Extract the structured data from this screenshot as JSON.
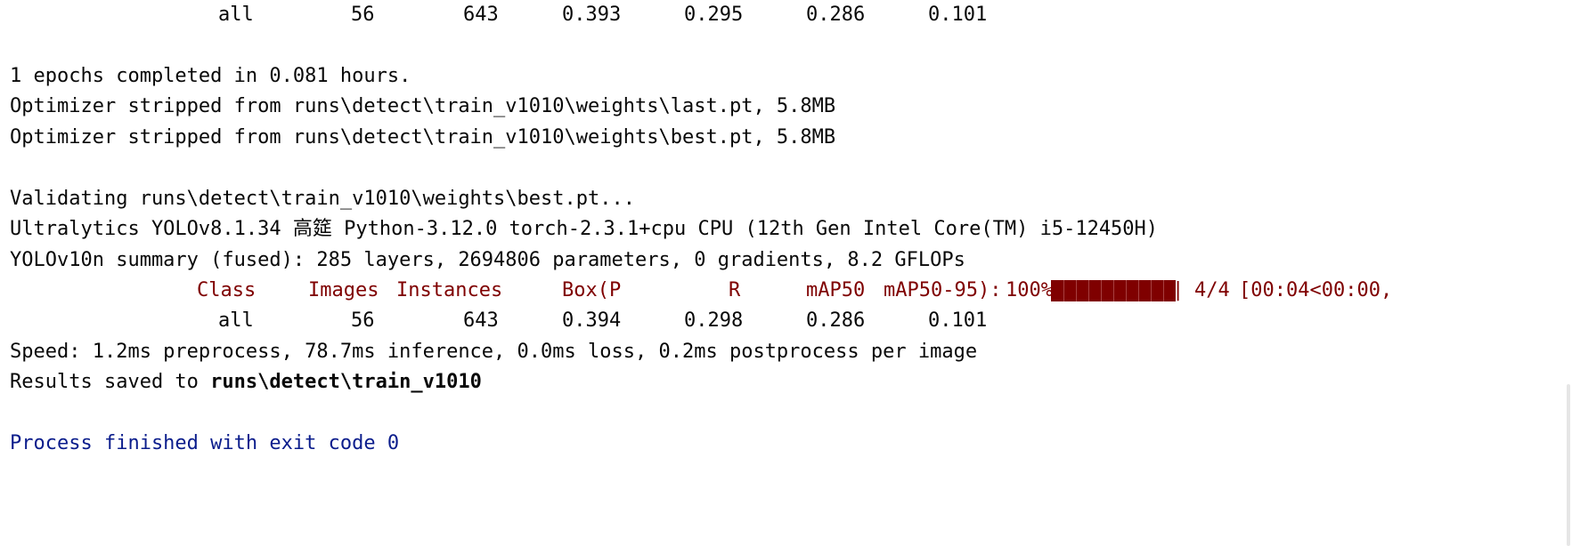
{
  "console": {
    "first_row": [
      "all",
      "56",
      "643",
      "0.393",
      "0.295",
      "0.286",
      "0.101"
    ],
    "epochs_line": "1 epochs completed in 0.081 hours.",
    "optimizer_last": "Optimizer stripped from runs\\detect\\train_v1010\\weights\\last.pt, 5.8MB",
    "optimizer_best": "Optimizer stripped from runs\\detect\\train_v1010\\weights\\best.pt, 5.8MB",
    "validating": "Validating runs\\detect\\train_v1010\\weights\\best.pt...",
    "ultralytics": "Ultralytics YOLOv8.1.34 高筵 Python-3.12.0 torch-2.3.1+cpu CPU (12th Gen Intel Core(TM) i5-12450H)",
    "summary": "YOLOv10n summary (fused): 285 layers, 2694806 parameters, 0 gradients, 8.2 GFLOPs",
    "header": {
      "class": "Class",
      "images": "Images",
      "instances": "Instances",
      "box_p": "Box(P",
      "r": "R",
      "map50": "mAP50",
      "map50_95": "mAP50-95):",
      "percent": "100%",
      "progress_left": "|",
      "progress_right": "|",
      "progress_value": 1.0,
      "count": "4/4",
      "time": "[00:04<00:00,"
    },
    "second_row": [
      "all",
      "56",
      "643",
      "0.394",
      "0.298",
      "0.286",
      "0.101"
    ],
    "speed": "Speed: 1.2ms preprocess, 78.7ms inference, 0.0ms loss, 0.2ms postprocess per image",
    "results_prefix": "Results saved to ",
    "results_path": "runs\\detect\\train_v1010",
    "process_finished": "Process finished with exit code 0"
  },
  "colors": {
    "text": "#080808",
    "header": "#7f0000",
    "exit": "#0b1d8c",
    "background": "#ffffff"
  }
}
